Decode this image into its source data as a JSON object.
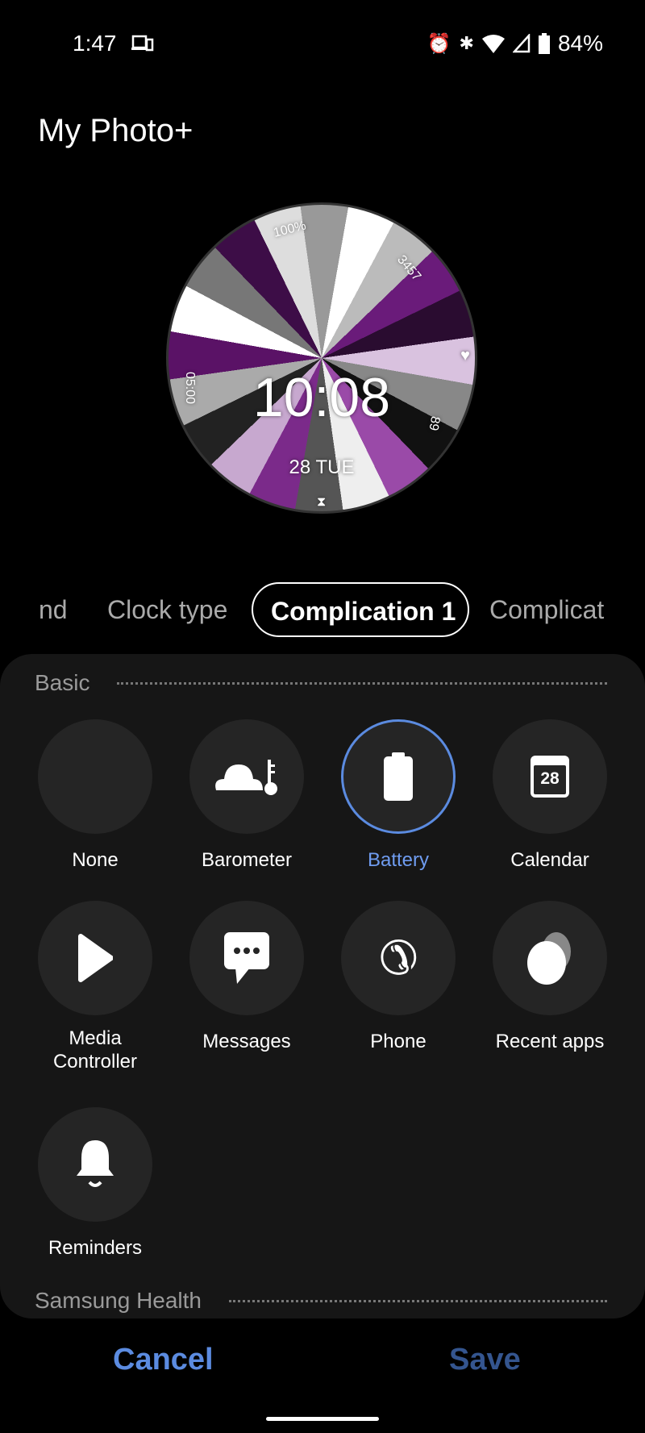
{
  "status_bar": {
    "time": "1:47",
    "battery": "84%",
    "icons": [
      "cast-device-icon",
      "alarm-icon",
      "bluetooth-icon",
      "wifi-icon",
      "signal-icon",
      "battery-icon"
    ]
  },
  "title": "My Photo+",
  "watch_face": {
    "time": "10:08",
    "date": "28 TUE",
    "battery": "100%",
    "steps": "3457",
    "heart_rate": "89",
    "sleep": "05:00"
  },
  "tabs": [
    {
      "label": "nd"
    },
    {
      "label": "Clock type"
    },
    {
      "label": "Complication 1",
      "active": true
    },
    {
      "label": "Complicat"
    }
  ],
  "sections": [
    {
      "title": "Basic"
    },
    {
      "title": "Samsung Health"
    }
  ],
  "items": [
    {
      "label": "None",
      "icon": "none"
    },
    {
      "label": "Barometer",
      "icon": "barometer-icon"
    },
    {
      "label": "Battery",
      "icon": "battery-icon",
      "selected": true
    },
    {
      "label": "Calendar",
      "icon": "calendar-icon",
      "day": "28"
    },
    {
      "label": "Media Controller",
      "icon": "play-icon"
    },
    {
      "label": "Messages",
      "icon": "message-icon"
    },
    {
      "label": "Phone",
      "icon": "phone-icon"
    },
    {
      "label": "Recent apps",
      "icon": "recent-apps-icon"
    },
    {
      "label": "Reminders",
      "icon": "bell-icon"
    }
  ],
  "actions": {
    "cancel": "Cancel",
    "save": "Save"
  },
  "colors": {
    "accent": "#5b8be0",
    "cancel": "#5b8be0",
    "save": "#34558f"
  }
}
